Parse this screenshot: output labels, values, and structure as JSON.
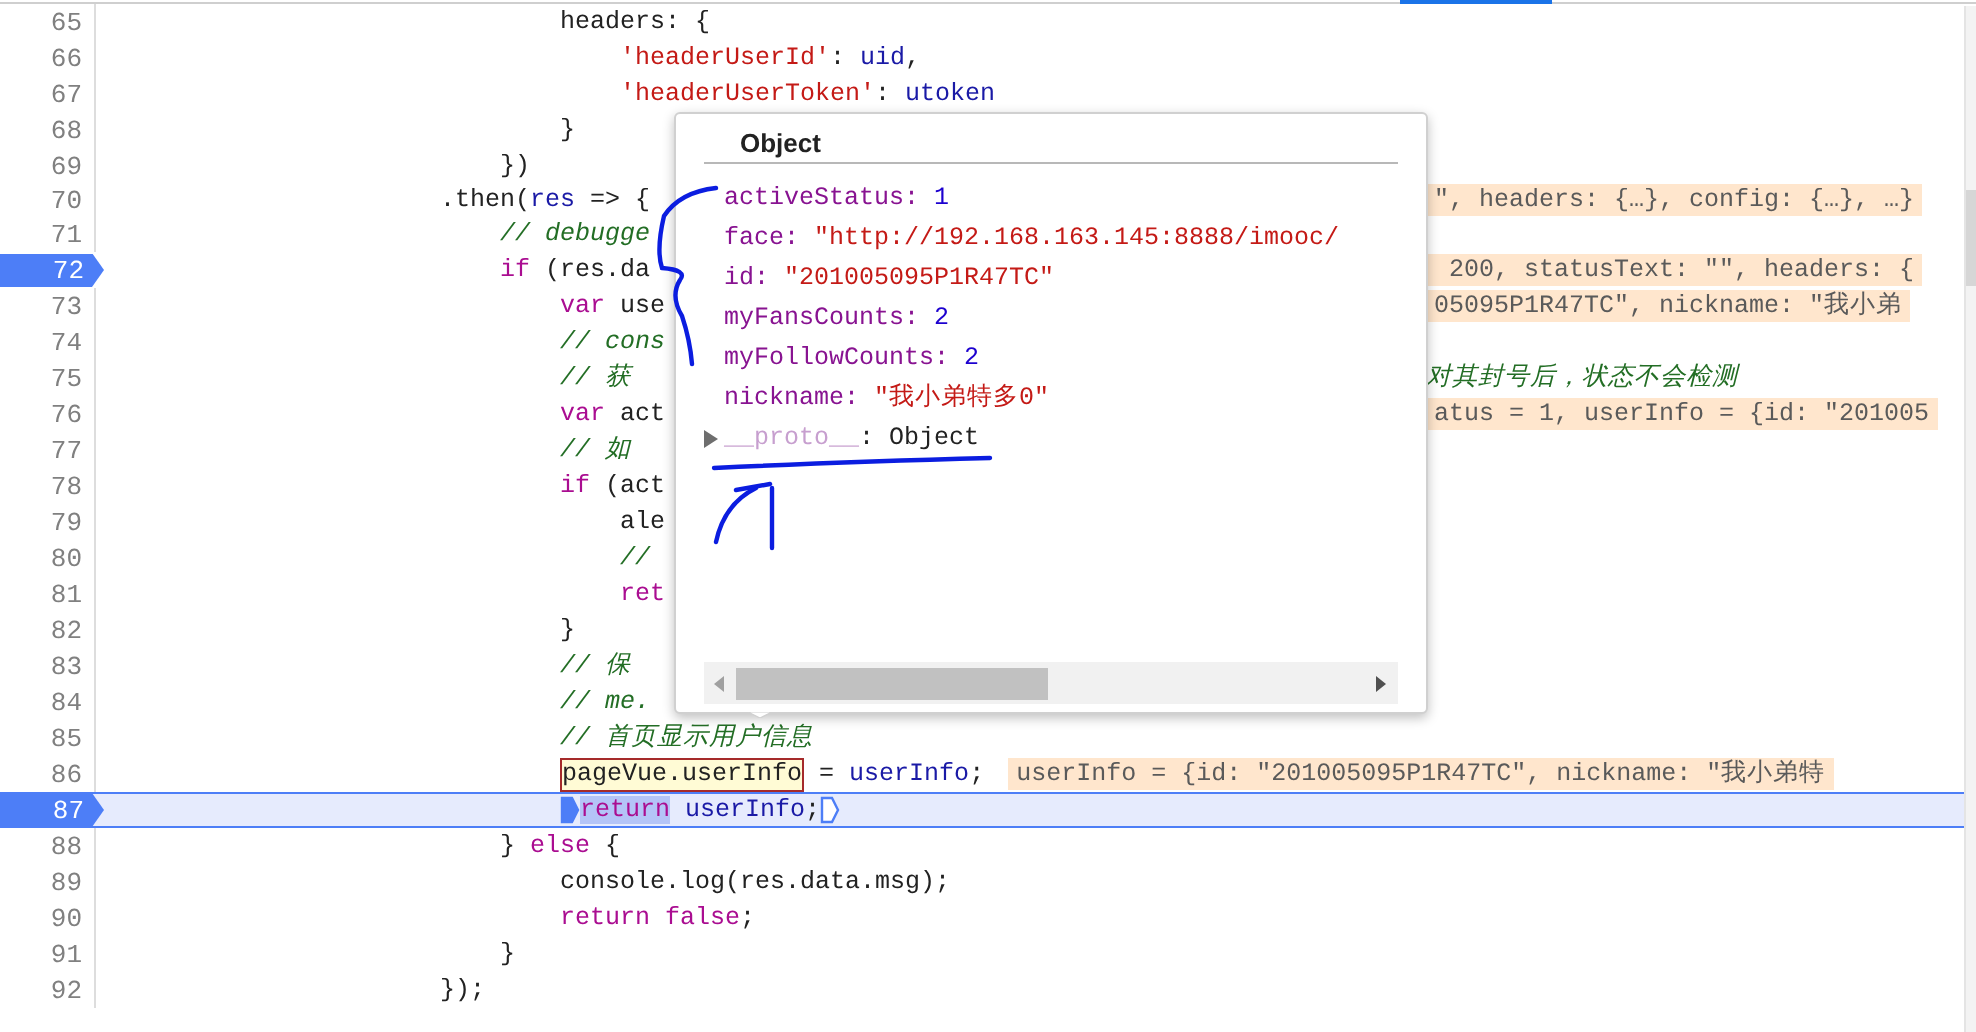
{
  "code_lines": [
    {
      "children": [
        {
          "children": [
            {
              "children": [
                {
                  "children": [
                    {
                      "number": "65",
                      "breakpoint": false,
                      "current": false,
                      "covered": false,
                      "tokens": [
                        {
                          "text": "headers: {",
                          "kind": "plain"
                        }
                      ]
                    },
                    {
                      "children": [
                        {
                          "number": "66",
                          "breakpoint": false,
                          "current": false,
                          "covered": false,
                          "tokens": [
                            {
                              "text": "'headerUserId'",
                              "kind": "string"
                            },
                            {
                              "text": ": ",
                              "kind": "plain"
                            },
                            {
                              "text": "uid",
                              "kind": "name"
                            },
                            {
                              "text": ",",
                              "kind": "plain"
                            }
                          ]
                        },
                        {
                          "number": "67",
                          "breakpoint": false,
                          "current": false,
                          "covered": false,
                          "tokens": [
                            {
                              "text": "'headerUserToken'",
                              "kind": "string"
                            },
                            {
                              "text": ": ",
                              "kind": "plain"
                            },
                            {
                              "text": "utoken",
                              "kind": "name"
                            }
                          ]
                        }
                      ]
                    },
                    {
                      "number": "68",
                      "breakpoint": false,
                      "current": false,
                      "covered": false,
                      "tokens": [
                        {
                          "text": "}",
                          "kind": "plain"
                        }
                      ]
                    }
                  ]
                },
                {
                  "number": "69",
                  "breakpoint": false,
                  "current": false,
                  "covered": false,
                  "tokens": [
                    {
                      "text": "})",
                      "kind": "plain"
                    }
                  ]
                }
              ]
            },
            {
              "number": "70",
              "breakpoint": false,
              "current": false,
              "covered": true,
              "tokens": [
                {
                  "text": ".then(",
                  "kind": "plain"
                },
                {
                  "text": "res",
                  "kind": "name"
                },
                {
                  "text": " => {",
                  "kind": "plain"
                }
              ],
              "trailing": {
                "kind": "value",
                "text": "\", headers: {…}, config: {…}, …}"
              }
            },
            {
              "children": [
                {
                  "number": "71",
                  "breakpoint": false,
                  "current": false,
                  "covered": true,
                  "tokens": [
                    {
                      "text": "// debugge",
                      "kind": "comment"
                    }
                  ]
                },
                {
                  "number": "72",
                  "breakpoint": true,
                  "current": false,
                  "covered": true,
                  "tokens": [
                    {
                      "text": "if",
                      "kind": "keyword"
                    },
                    {
                      "text": " (res.da",
                      "kind": "plain"
                    }
                  ],
                  "trailing": {
                    "kind": "value",
                    "text": " 200, statusText: \"\", headers: {"
                  }
                },
                {
                  "children": [
                    {
                      "number": "73",
                      "breakpoint": false,
                      "current": false,
                      "covered": true,
                      "tokens": [
                        {
                          "text": "var",
                          "kind": "keyword"
                        },
                        {
                          "text": " use",
                          "kind": "plain"
                        }
                      ],
                      "trailing": {
                        "kind": "value",
                        "text": "05095P1R47TC\", nickname: \"我小弟"
                      }
                    },
                    {
                      "number": "74",
                      "breakpoint": false,
                      "current": false,
                      "covered": true,
                      "tokens": [
                        {
                          "text": "// cons",
                          "kind": "comment"
                        }
                      ]
                    },
                    {
                      "number": "75",
                      "breakpoint": false,
                      "current": false,
                      "covered": true,
                      "tokens": [
                        {
                          "text": "// 获",
                          "kind": "comment"
                        }
                      ],
                      "trailing": {
                        "kind": "comment",
                        "text": "对其封号后，状态不会检测"
                      }
                    },
                    {
                      "number": "76",
                      "breakpoint": false,
                      "current": false,
                      "covered": true,
                      "tokens": [
                        {
                          "text": "var",
                          "kind": "keyword"
                        },
                        {
                          "text": " act",
                          "kind": "plain"
                        }
                      ],
                      "trailing": {
                        "kind": "value",
                        "text": "atus = 1, userInfo = {id: \"201005"
                      }
                    },
                    {
                      "number": "77",
                      "breakpoint": false,
                      "current": false,
                      "covered": true,
                      "tokens": [
                        {
                          "text": "// 如",
                          "kind": "comment"
                        }
                      ]
                    },
                    {
                      "number": "78",
                      "breakpoint": false,
                      "current": false,
                      "covered": true,
                      "tokens": [
                        {
                          "text": "if",
                          "kind": "keyword"
                        },
                        {
                          "text": " (act",
                          "kind": "plain"
                        }
                      ]
                    },
                    {
                      "children": [
                        {
                          "number": "79",
                          "breakpoint": false,
                          "current": false,
                          "covered": true,
                          "tokens": [
                            {
                              "text": "ale",
                              "kind": "plain"
                            }
                          ]
                        },
                        {
                          "number": "80",
                          "breakpoint": false,
                          "current": false,
                          "covered": true,
                          "tokens": [
                            {
                              "text": "//",
                              "kind": "comment"
                            }
                          ]
                        },
                        {
                          "number": "81",
                          "breakpoint": false,
                          "current": false,
                          "covered": true,
                          "tokens": [
                            {
                              "text": "ret",
                              "kind": "keyword"
                            }
                          ]
                        }
                      ]
                    },
                    {
                      "number": "82",
                      "breakpoint": false,
                      "current": false,
                      "covered": true,
                      "tokens": [
                        {
                          "text": "}",
                          "kind": "plain"
                        }
                      ]
                    },
                    {
                      "number": "83",
                      "breakpoint": false,
                      "current": false,
                      "covered": true,
                      "tokens": [
                        {
                          "text": "// 保",
                          "kind": "comment"
                        }
                      ]
                    },
                    {
                      "number": "84",
                      "breakpoint": false,
                      "current": false,
                      "covered": true,
                      "tokens": [
                        {
                          "text": "// me.",
                          "kind": "comment"
                        }
                      ]
                    },
                    {
                      "number": "85",
                      "breakpoint": false,
                      "current": false,
                      "covered": false,
                      "tokens": [
                        {
                          "text": "// 首页显示用户信息",
                          "kind": "comment"
                        }
                      ]
                    },
                    {
                      "number": "86",
                      "breakpoint": false,
                      "current": false,
                      "covered": false,
                      "tokens": [
                        {
                          "text": "pageVue.userInfo",
                          "kind": "hovered"
                        },
                        {
                          "text": " = ",
                          "kind": "plain"
                        },
                        {
                          "text": "userInfo",
                          "kind": "name"
                        },
                        {
                          "text": ";",
                          "kind": "plain"
                        }
                      ],
                      "trailing": {
                        "kind": "value",
                        "text": "userInfo = {id: \"201005095P1R47TC\", nickname: \"我小弟特"
                      }
                    },
                    {
                      "number": "87",
                      "breakpoint": true,
                      "current": true,
                      "covered": false,
                      "tokens": [
                        {
                          "kind": "marker",
                          "filled": true
                        },
                        {
                          "text": "return",
                          "kind": "selected-keyword"
                        },
                        {
                          "text": " userInfo",
                          "kind": "name"
                        },
                        {
                          "text": ";",
                          "kind": "plain"
                        },
                        {
                          "kind": "marker",
                          "filled": false
                        }
                      ]
                    }
                  ]
                },
                {
                  "number": "88",
                  "breakpoint": false,
                  "current": false,
                  "covered": false,
                  "tokens": [
                    {
                      "text": "} ",
                      "kind": "plain"
                    },
                    {
                      "text": "else",
                      "kind": "keyword"
                    },
                    {
                      "text": " {",
                      "kind": "plain"
                    }
                  ]
                },
                {
                  "children": [
                    {
                      "number": "89",
                      "breakpoint": false,
                      "current": false,
                      "covered": false,
                      "tokens": [
                        {
                          "text": "console.log(res.data.msg);",
                          "kind": "plain"
                        }
                      ]
                    },
                    {
                      "number": "90",
                      "breakpoint": false,
                      "current": false,
                      "covered": false,
                      "tokens": [
                        {
                          "text": "return",
                          "kind": "keyword"
                        },
                        {
                          "text": " false",
                          "kind": "keyword"
                        },
                        {
                          "text": ";",
                          "kind": "plain"
                        }
                      ]
                    }
                  ]
                },
                {
                  "number": "91",
                  "breakpoint": false,
                  "current": false,
                  "covered": false,
                  "tokens": [
                    {
                      "text": "}",
                      "kind": "plain"
                    }
                  ]
                }
              ]
            },
            {
              "number": "92",
              "breakpoint": false,
              "current": false,
              "covered": false,
              "tokens": [
                {
                  "text": "});",
                  "kind": "plain"
                }
              ]
            }
          ]
        }
      ]
    }
  ],
  "popover": {
    "title": "Object",
    "properties": [
      {
        "key": "activeStatus:",
        "value": "1",
        "kind": "number"
      },
      {
        "key": "face:",
        "value": "\"http://192.168.163.145:8888/imooc/",
        "kind": "string"
      },
      {
        "key": "id:",
        "value": "\"201005095P1R47TC\"",
        "kind": "string"
      },
      {
        "key": "myFansCounts:",
        "value": "2",
        "kind": "number"
      },
      {
        "key": "myFollowCounts:",
        "value": "2",
        "kind": "number"
      },
      {
        "key": "nickname:",
        "value": "\"我小弟特多0\"",
        "kind": "string"
      },
      {
        "key": "__proto__",
        "separator": ":",
        "value": "Object",
        "kind": "prototype",
        "expanded": false
      }
    ]
  }
}
